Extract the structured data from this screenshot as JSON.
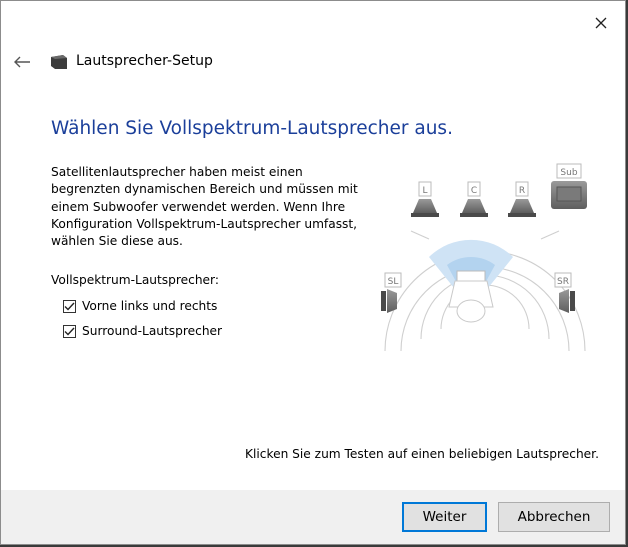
{
  "window": {
    "title": "Lautsprecher-Setup",
    "icons": {
      "close": "close-icon",
      "back": "back-arrow-icon",
      "app": "speaker-icon"
    }
  },
  "page": {
    "heading": "Wählen Sie Vollspektrum-Lautsprecher aus.",
    "description": "Satellitenlautsprecher haben meist einen begrenzten dynamischen Bereich und müssen mit einem Subwoofer verwendet werden. Wenn Ihre Konfiguration Vollspektrum-Lautsprecher umfasst, wählen Sie diese aus.",
    "section_label": "Vollspektrum-Lautsprecher:",
    "checkboxes": [
      {
        "label": "Vorne links und rechts",
        "checked": true
      },
      {
        "label": "Surround-Lautsprecher",
        "checked": true
      }
    ],
    "speakers": {
      "left": "L",
      "center": "C",
      "right": "R",
      "sub": "Sub",
      "surround_left": "SL",
      "surround_right": "SR"
    },
    "hint": "Klicken Sie zum Testen auf einen beliebigen Lautsprecher."
  },
  "buttons": {
    "next": "Weiter",
    "cancel": "Abbrechen"
  },
  "colors": {
    "heading": "#1b3f9a",
    "primary_border": "#0078d7",
    "footer_bg": "#f0f0f0"
  }
}
